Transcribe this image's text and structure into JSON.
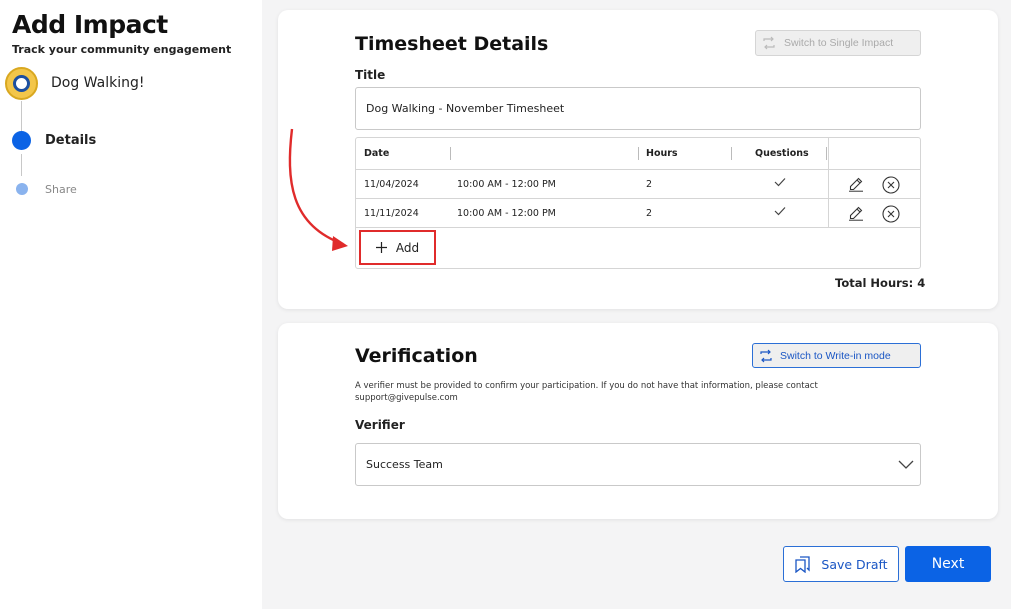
{
  "header": {
    "title": "Add Impact",
    "subtitle": "Track your community engagement"
  },
  "organization": {
    "name": "Dog Walking!"
  },
  "steps": [
    {
      "label": "Details",
      "state": "active"
    },
    {
      "label": "Share",
      "state": "upcoming"
    }
  ],
  "timesheet": {
    "section_title": "Timesheet Details",
    "switch_label": "Switch to Single Impact",
    "title_label": "Title",
    "title_value": "Dog Walking - November Timesheet",
    "columns": [
      "Date",
      "",
      "Hours",
      "Questions"
    ],
    "rows": [
      {
        "date": "11/04/2024",
        "time": "10:00 AM - 12:00 PM",
        "hours": "2",
        "questions_icon": "check-icon"
      },
      {
        "date": "11/11/2024",
        "time": "10:00 AM - 12:00 PM",
        "hours": "2",
        "questions_icon": "check-icon"
      }
    ],
    "add_label": "Add",
    "total_hours_label": "Total Hours: 4"
  },
  "verification": {
    "section_title": "Verification",
    "switch_label": "Switch to Write-in mode",
    "description": "A verifier must be provided to confirm your participation. If you do not have that information, please contact support@givepulse.com",
    "verifier_label": "Verifier",
    "verifier_value": "Success Team"
  },
  "footer": {
    "save_draft_label": "Save Draft",
    "next_label": "Next"
  },
  "colors": {
    "accent": "#0b63e5",
    "annotation_red": "#e02b2b"
  }
}
